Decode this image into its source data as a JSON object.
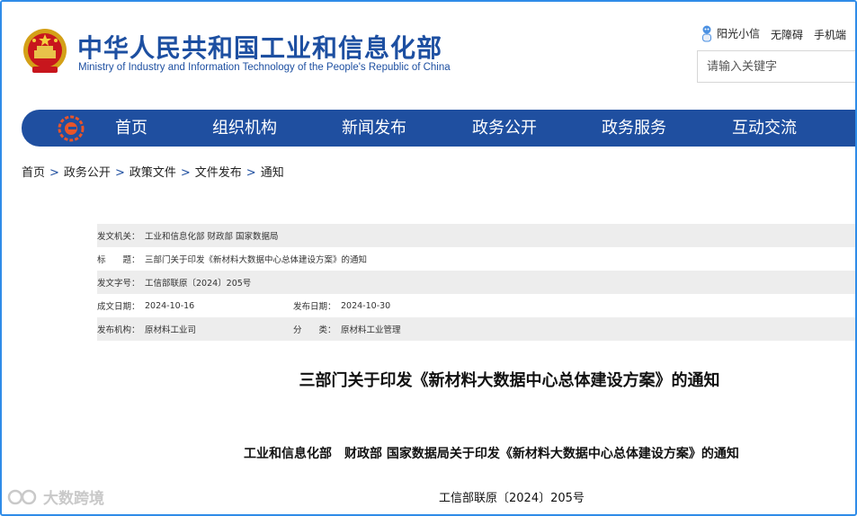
{
  "header": {
    "title_cn": "中华人民共和国工业和信息化部",
    "title_en": "Ministry of Industry and Information Technology of the People's Republic of China",
    "links": [
      "阳光小信",
      "无障碍",
      "手机端"
    ],
    "search_placeholder": "请输入关键字"
  },
  "nav": {
    "items": [
      "首页",
      "组织机构",
      "新闻发布",
      "政务公开",
      "政务服务",
      "互动交流"
    ]
  },
  "breadcrumb": [
    "首页",
    "政务公开",
    "政策文件",
    "文件发布",
    "通知"
  ],
  "meta": {
    "issuer_label": "发文机关：",
    "issuer_value": "工业和信息化部 财政部 国家数据局",
    "title_label": "标　　题：",
    "title_value": "三部门关于印发《新材料大数据中心总体建设方案》的通知",
    "docno_label": "发文字号：",
    "docno_value": "工信部联原〔2024〕205号",
    "created_label": "成文日期：",
    "created_value": "2024-10-16",
    "published_label": "发布日期：",
    "published_value": "2024-10-30",
    "org_label": "发布机构：",
    "org_value": "原材料工业司",
    "category_label": "分　　类：",
    "category_value": "原材料工业管理"
  },
  "article": {
    "title": "三部门关于印发《新材料大数据中心总体建设方案》的通知",
    "subtitle": "工业和信息化部　财政部  国家数据局关于印发《新材料大数据中心总体建设方案》的通知",
    "doc_number": "工信部联原〔2024〕205号"
  },
  "watermark": {
    "text": "大数跨境"
  },
  "colors": {
    "brand_blue": "#1f4fa0",
    "frame_blue": "#2f8ce8",
    "meta_shade": "#ededed"
  }
}
